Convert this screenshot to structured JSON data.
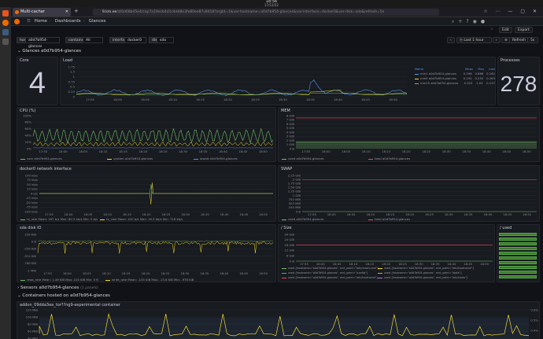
{
  "os": {
    "clock": "18:56",
    "date": "17/12/22"
  },
  "browser": {
    "tab_title": "Multi-cachar",
    "url_host": "9.km.ee",
    "url_rest": "/d/0d08b45e4/cap7a19ecb4d1c4dd8e3fe80ee87c8d18?orgId=1&var-hostname=a0d7b954-glances&var-interface=docker0&var-disk=sda&refresh=5s"
  },
  "nav": {
    "home": "Home",
    "dashboards": "Dashboards",
    "current": "Glances"
  },
  "toolbar": {
    "edit": "Edit",
    "export": "Export",
    "time": "Last 1 hour",
    "refresh": "Refresh",
    "interval": "5s"
  },
  "variables": [
    {
      "label": "host",
      "value": "a0d7b954-glances"
    },
    {
      "label": "container",
      "value": "All"
    },
    {
      "label": "interface",
      "value": "docker0"
    },
    {
      "label": "disk",
      "value": "sda"
    }
  ],
  "rows": {
    "glances": "Glances a0d7b954-glances",
    "sensors": "Sensors a0d7b954-glances",
    "sensors_count": "(1 panels)",
    "containers": "Containers hosted on a0d7b954-glances"
  },
  "panels": {
    "core": {
      "title": "Core",
      "value": "4"
    },
    "load": {
      "title": "Load",
      "legend_head": [
        "Name",
        "Mean",
        "Max",
        "Last"
      ],
      "legend": [
        {
          "name": "min1 a0d7b954-glances",
          "mean": "0.298",
          "max": "0.866",
          "last": "0.162",
          "color": "#5794f2"
        },
        {
          "name": "min5 a0d7b954-glances",
          "mean": "0.192",
          "max": "0.253",
          "last": "0.163",
          "color": "#fade2a"
        },
        {
          "name": "min15 a0d7b954-glances",
          "mean": "0.223",
          "max": "1.04",
          "last": "0.137",
          "color": "#73bf69"
        }
      ],
      "yticks": [
        "1.75",
        "1.5",
        "1",
        "0.75",
        "0.5",
        "0.25",
        "0"
      ],
      "xticks": [
        "17:55",
        "18:00",
        "18:05",
        "18:10",
        "18:15",
        "18:20",
        "18:25",
        "18:30",
        "18:35",
        "18:40",
        "18:45",
        "18:50"
      ]
    },
    "processes": {
      "title": "Processes",
      "value": "278"
    },
    "cpu": {
      "title": "CPU (%)",
      "legend": [
        {
          "name": "user a0d7b954-glances",
          "color": "#73bf69"
        },
        {
          "name": "system a0d7b954-glances",
          "color": "#fade2a"
        },
        {
          "name": "iowait a0d7b954-glances",
          "color": "#5794f2"
        }
      ],
      "yticks": [
        "100%",
        "80%",
        "60%",
        "40%",
        "20%",
        "0%"
      ],
      "xticks": [
        "17:55",
        "18:00",
        "18:05",
        "18:10",
        "18:15",
        "18:20",
        "18:25",
        "18:30",
        "18:35",
        "18:40",
        "18:45",
        "18:50"
      ]
    },
    "mem": {
      "title": "MEM",
      "legend": [
        {
          "name": "used a0d7b954-glances",
          "color": "#73bf69"
        },
        {
          "name": "total a0d7b954-glances",
          "color": "#f2495c"
        }
      ],
      "yticks": [
        "8 GiB",
        "7 GiB",
        "6 GiB",
        "5 GiB",
        "4 GiB",
        "3 GiB",
        "2 GiB",
        "1 GiB",
        "0 B"
      ],
      "xticks": [
        "17:55",
        "18:00",
        "18:05",
        "18:10",
        "18:15",
        "18:20",
        "18:25",
        "18:30",
        "18:35",
        "18:40",
        "18:45",
        "18:50"
      ]
    },
    "net": {
      "title": "docker0 network interface",
      "legend": [
        {
          "name": "rx_rate  Mean: 297 b/s  Max: 80.3 kb/s  Min: 0 b/s",
          "color": "#73bf69"
        },
        {
          "name": "tx_rate  Mean: 430 b/s  Max: 16.5 kb/s  Min: 716 kb/s",
          "color": "#fade2a"
        }
      ],
      "yticks": [
        "100 kb/s",
        "75 kb/s",
        "50 kb/s",
        "25 kb/s",
        "0 b/s",
        "-25 kb/s",
        "-50 kb/s",
        "-75 kb/s",
        "-100 kb/s"
      ],
      "xticks": [
        "17:55",
        "18:00",
        "18:05",
        "18:10",
        "18:15",
        "18:20",
        "18:25",
        "18:30",
        "18:35",
        "18:40",
        "18:45",
        "18:50"
      ]
    },
    "swap": {
      "title": "SWAP",
      "legend": [
        {
          "name": "used a0d7b954-glances",
          "color": "#73bf69"
        },
        {
          "name": "total a0d7b954-glances",
          "color": "#f2495c"
        }
      ],
      "yticks": [
        "2.25 GiB",
        "2 GiB",
        "1.75 GiB",
        "1.50 GiB",
        "1.25 GiB",
        "1 GiB",
        "750 MiB",
        "500 MiB",
        "250 MiB",
        "0 B"
      ],
      "xticks": [
        "17:55",
        "18:00",
        "18:05",
        "18:10",
        "18:15",
        "18:20",
        "18:25",
        "18:30",
        "18:35",
        "18:40",
        "18:45",
        "18:50"
      ]
    },
    "disk": {
      "title": "sda disk IO",
      "legend": [
        {
          "name": "read_rate  Mean: 1.49 KiB  Max: 224 KiB  Min: 0 B",
          "color": "#73bf69"
        },
        {
          "name": "write_rate  Mean: -135 KiB  Max: -13.8 KiB  Min: -978 KiB",
          "color": "#fade2a"
        }
      ],
      "yticks": [
        "256 KiB",
        "0 B",
        "-256 KiB",
        "-512 KiB",
        "-768 KiB",
        "-1 MiB"
      ],
      "xticks": [
        "17:55",
        "18:00",
        "18:05",
        "18:10",
        "18:15",
        "18:20",
        "18:25",
        "18:30",
        "18:35",
        "18:40",
        "18:45",
        "18:50"
      ]
    },
    "fs": {
      "title": "/ Size",
      "legend": [
        {
          "name": "used {hostname=\"a0d7b954-glances\", mnt_point=\"/etc/resolv.conf\"}",
          "color": "#73bf69"
        },
        {
          "name": "used {hostname=\"a0d7b954-glances\", mnt_point=\"/etc/hostname\"}",
          "color": "#fade2a"
        },
        {
          "name": "used {hostname=\"a0d7b954-glances\", mnt_point=\"/config\"}",
          "color": "#5794f2"
        },
        {
          "name": "used {hostname=\"a0d7b954-glances\", mnt_point=\"/data\"}",
          "color": "#ff9830"
        },
        {
          "name": "used {hostname=\"a0d7b954-glances\", mnt_point=\"/etc/hostname\"}",
          "color": "#f2495c"
        },
        {
          "name": "used {hostname=\"a0d7b954-glances\", mnt_point=\"/etc/hosts\"}",
          "color": "#b877d9"
        }
      ],
      "yticks": [
        "30 GiB",
        "24 GiB",
        "18 GiB",
        "12 GiB",
        "6 GiB",
        "0 B"
      ],
      "xticks": [
        "17:55",
        "18:00",
        "18:05",
        "18:10",
        "18:15",
        "18:20",
        "18:25",
        "18:30",
        "18:35",
        "18:40",
        "18:45",
        "18:50"
      ]
    },
    "used": {
      "title": "/ used",
      "bars": [
        0.95,
        0.95,
        0.95,
        0.95,
        0.95,
        0.95,
        0.95,
        0.95,
        0.95,
        0.95
      ]
    },
    "container": {
      "title": "addon_09dda3ea_tor??ng9-experimental container",
      "yticks": [
        "120 MiB",
        "100 MiB",
        "80 MiB",
        "60 MiB",
        "40 MiB"
      ],
      "right_ticks": [
        "0.6%",
        "0.5%",
        "0.4%"
      ]
    }
  }
}
